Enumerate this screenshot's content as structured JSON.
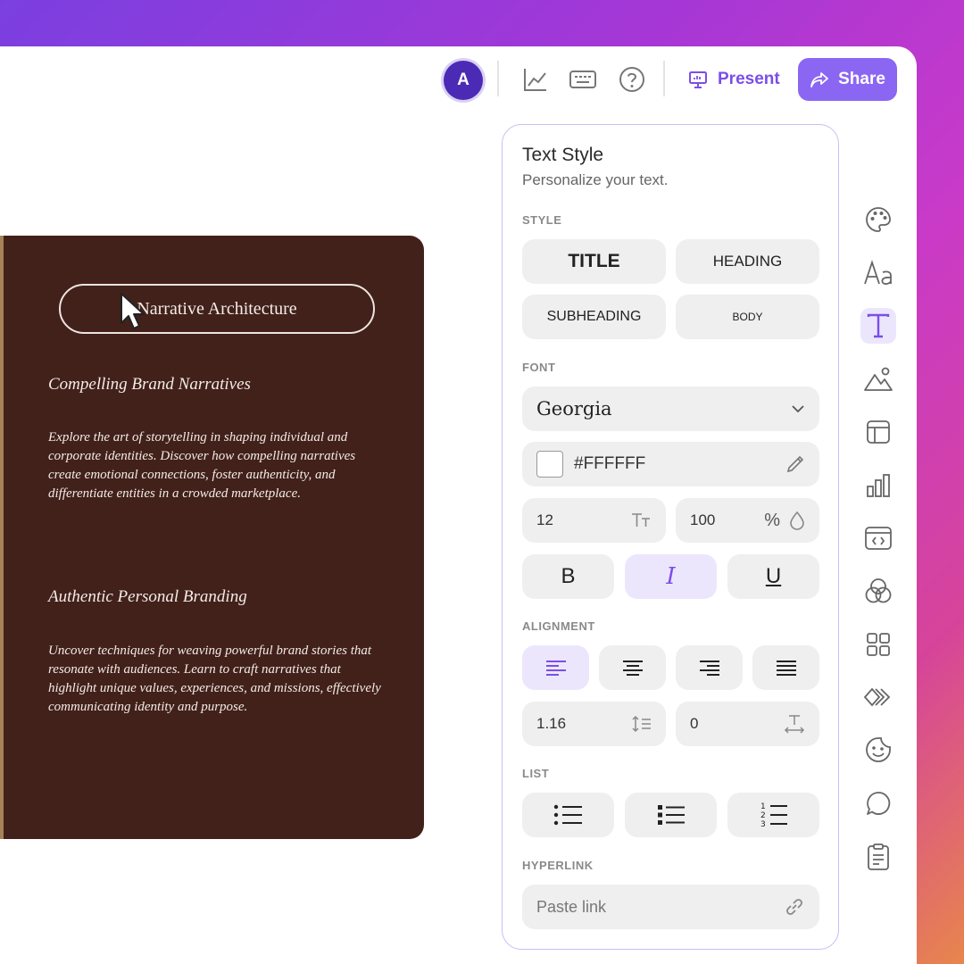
{
  "topbar": {
    "avatar_letter": "A",
    "present_label": "Present",
    "share_label": "Share"
  },
  "slide": {
    "title_pill": "Narrative Architecture",
    "section1_heading": "Compelling Brand Narratives",
    "section1_body": "Explore the art of storytelling in shaping individual and corporate identities. Discover how compelling narratives create emotional connections, foster authenticity, and differentiate entities in a crowded marketplace.",
    "section2_heading": "Authentic Personal Branding",
    "section2_body": "Uncover techniques for weaving powerful brand stories that resonate with audiences. Learn to craft narratives that highlight unique values, experiences, and missions, effectively communicating identity and purpose."
  },
  "panel": {
    "title": "Text Style",
    "subtitle": "Personalize your text.",
    "style_label": "STYLE",
    "style_buttons": [
      "TITLE",
      "HEADING",
      "SUBHEADING",
      "BODY"
    ],
    "font_label": "FONT",
    "font_value": "Georgia",
    "color_value": "#FFFFFF",
    "size_value": "12",
    "opacity_value": "100",
    "opacity_unit": "%",
    "format_buttons": [
      "B",
      "I",
      "U"
    ],
    "alignment_label": "ALIGNMENT",
    "line_height_value": "1.16",
    "letter_spacing_value": "0",
    "list_label": "LIST",
    "hyperlink_label": "HYPERLINK",
    "hyperlink_placeholder": "Paste link"
  },
  "colors": {
    "accent": "#8b66f3",
    "slide_bg": "#42211a",
    "active_bg": "#ece6fd"
  }
}
